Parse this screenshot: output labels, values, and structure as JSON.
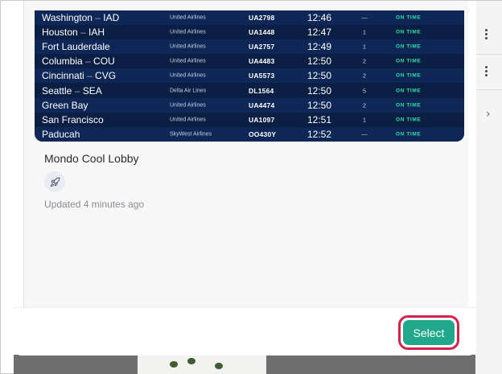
{
  "flights": [
    {
      "city": "Washington",
      "code": "IAD",
      "airline": "United Airlines",
      "flight": "UA2798",
      "time": "12:46",
      "gate": "—",
      "status": "ON TIME"
    },
    {
      "city": "Houston",
      "code": "IAH",
      "airline": "United Airlines",
      "flight": "UA1448",
      "time": "12:47",
      "gate": "1",
      "status": "ON TIME"
    },
    {
      "city": "Fort Lauderdale",
      "code": "",
      "airline": "United Airlines",
      "flight": "UA2757",
      "time": "12:49",
      "gate": "1",
      "status": "ON TIME"
    },
    {
      "city": "Columbia",
      "code": "COU",
      "airline": "United Airlines",
      "flight": "UA4483",
      "time": "12:50",
      "gate": "2",
      "status": "ON TIME"
    },
    {
      "city": "Cincinnati",
      "code": "CVG",
      "airline": "United Airlines",
      "flight": "UA5573",
      "time": "12:50",
      "gate": "2",
      "status": "ON TIME"
    },
    {
      "city": "Seattle",
      "code": "SEA",
      "airline": "Delta Air Lines",
      "flight": "DL1564",
      "time": "12:50",
      "gate": "5",
      "status": "ON TIME"
    },
    {
      "city": "Green Bay",
      "code": "",
      "airline": "United Airlines",
      "flight": "UA4474",
      "time": "12:50",
      "gate": "2",
      "status": "ON TIME"
    },
    {
      "city": "San Francisco",
      "code": "",
      "airline": "United Airlines",
      "flight": "UA1097",
      "time": "12:51",
      "gate": "1",
      "status": "ON TIME"
    },
    {
      "city": "Paducah",
      "code": "",
      "airline": "SkyWest Airlines",
      "flight": "OO430Y",
      "time": "12:52",
      "gate": "—",
      "status": "ON TIME"
    }
  ],
  "card": {
    "title": "Mondo Cool Lobby",
    "icon": "rocket-icon",
    "updated": "Updated 4 minutes ago"
  },
  "footer": {
    "select_label": "Select"
  },
  "colors": {
    "accent": "#21a88b",
    "highlight": "#d6224b",
    "board_bg": "#0b1f44",
    "status_green": "#2fe0a0"
  }
}
